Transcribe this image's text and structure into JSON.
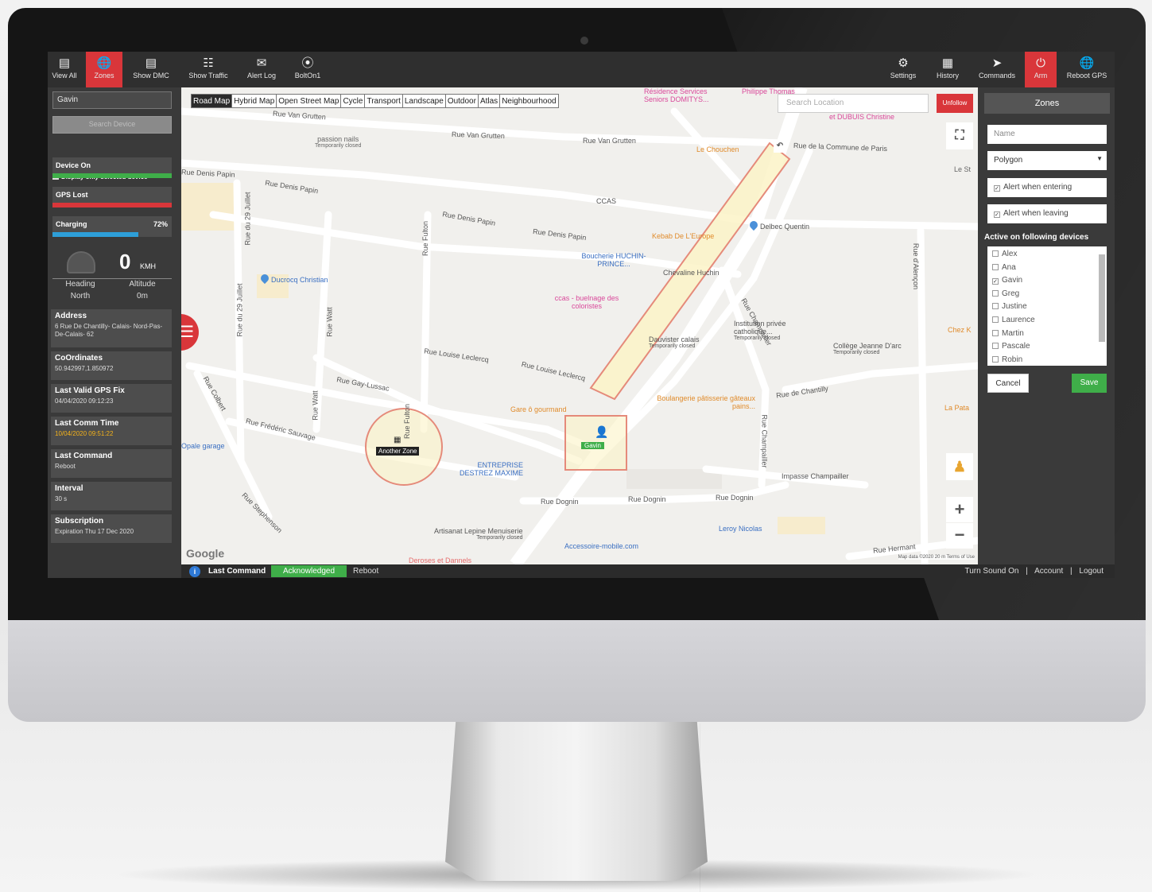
{
  "colors": {
    "accent": "#d9363a",
    "success": "#3fae49",
    "charging": "#2e9fd8",
    "panel": "#3a3a3a",
    "zone_fill": "#fbf3c7",
    "zone_stroke": "#e58a7a"
  },
  "toolbar_left": [
    {
      "label": "View All",
      "icon": "monitor-icon"
    },
    {
      "label": "Zones",
      "icon": "globe-icon",
      "active": true
    },
    {
      "label": "Show DMC",
      "icon": "monitor-icon"
    },
    {
      "label": "Show Traffic",
      "icon": "traffic-light-icon"
    },
    {
      "label": "Alert Log",
      "icon": "envelope-icon"
    },
    {
      "label": "BoltOn1",
      "icon": "bolt-icon"
    }
  ],
  "toolbar_right": [
    {
      "label": "Settings",
      "icon": "gears-icon"
    },
    {
      "label": "History",
      "icon": "calendar-icon"
    },
    {
      "label": "Commands",
      "icon": "paper-plane-icon"
    },
    {
      "label": "Arm",
      "icon": "power-icon",
      "active": true
    },
    {
      "label": "Reboot GPS",
      "icon": "globe-icon"
    }
  ],
  "left_panel": {
    "device_select": "Gavin",
    "search_placeholder": "Search Device",
    "display_only_selected": "Display only selected device",
    "device_on": "Device On",
    "gps_lost": "GPS Lost",
    "charging": "Charging",
    "charging_pct": "72%",
    "charging_level": 0.72,
    "speed": "0",
    "speed_unit": "KMH",
    "heading_label": "Heading",
    "heading_value": "North",
    "altitude_label": "Altitude",
    "altitude_value": "0m",
    "info": [
      {
        "title": "Address",
        "value": "6 Rue De Chantilly- Calais- Nord-Pas-De-Calais- 62"
      },
      {
        "title": "CoOrdinates",
        "value": "50.942997,1.850972"
      },
      {
        "title": "Last Valid GPS Fix",
        "value": "04/04/2020 09:12:23"
      },
      {
        "title": "Last Comm Time",
        "value": "10/04/2020 09:51:22",
        "warn": true
      },
      {
        "title": "Last Command",
        "value": "Reboot"
      },
      {
        "title": "Interval",
        "value": "30 s"
      },
      {
        "title": "Subscription",
        "value": "Expiration Thu 17 Dec 2020"
      }
    ]
  },
  "map": {
    "types": [
      "Road Map",
      "Hybrid Map",
      "Open Street Map",
      "Cycle",
      "Transport",
      "Landscape",
      "Outdoor",
      "Atlas",
      "Neighbourhood"
    ],
    "selected_type": "Road Map",
    "search_placeholder": "Search Location",
    "unfollow": "Unfollow",
    "zone_label": "Another Zone",
    "device_label": "Gavin",
    "google": "Google",
    "footer": "Map data ©2020   20 m   Terms of Use",
    "streets": [
      "Rue Van Grutten",
      "Rue Van Grutten",
      "Rue Van Grutten",
      "Rue de la Commune de Paris",
      "Rue Denis Papin",
      "Rue Denis Papin",
      "Rue Denis Papin",
      "Rue Denis Papin",
      "Rue du 29 Juillet",
      "Rue du 29 Juillet",
      "Rue Fulton",
      "Rue Watt",
      "Rue Watt",
      "Rue Louise Leclercq",
      "Rue Louise Leclercq",
      "Rue Gay-Lussac",
      "Rue Frédéric Sauvage",
      "Rue Colbert",
      "Rue Stephenson",
      "Rue Dognin",
      "Rue Dognin",
      "Rue Dognin",
      "Rue de Chantilly",
      "Rue Champailler",
      "Impasse Champailler",
      "Rue Hermant",
      "Rue d'Alençon",
      "Rue Champailler",
      "Rue Fulton"
    ],
    "pois": [
      {
        "name": "passion nails",
        "sub": "Temporarily closed"
      },
      {
        "name": "CCAS"
      },
      {
        "name": "Delbec Quentin"
      },
      {
        "name": "Ducrocq Christian"
      },
      {
        "name": "Boucherie HUCHIN-PRINCE..."
      },
      {
        "name": "Chevaline Huchin"
      },
      {
        "name": "Kebab De L'Europe"
      },
      {
        "name": "ccas - buelnage des coloristes"
      },
      {
        "name": "Institution privée catholique...",
        "sub": "Temporarily closed"
      },
      {
        "name": "Dauvister calais",
        "sub": "Temporarily closed"
      },
      {
        "name": "Collège Jeanne D'arc",
        "sub": "Temporarily closed"
      },
      {
        "name": "Boulangerie pâtisserie gâteaux pains..."
      },
      {
        "name": "Gare ô gourmand"
      },
      {
        "name": "ENTREPRISE DESTREZ MAXIME"
      },
      {
        "name": "Artisanat Lepine Menuiserie",
        "sub": "Temporarily closed"
      },
      {
        "name": "Accessoire-mobile.com"
      },
      {
        "name": "Leroy Nicolas"
      },
      {
        "name": "Deroses et Dannels"
      },
      {
        "name": "Opale garage"
      },
      {
        "name": "Le Chouchen"
      },
      {
        "name": "Résidence Services Seniors DOMITYS..."
      },
      {
        "name": "Philippe Thomas"
      },
      {
        "name": "et DUBUIS Christine"
      },
      {
        "name": "Chez K"
      },
      {
        "name": "La Pata"
      },
      {
        "name": "Le St"
      }
    ]
  },
  "right_panel": {
    "title": "Zones",
    "name_placeholder": "Name",
    "shape": "Polygon",
    "alert_entering": "Alert when entering",
    "alert_leaving": "Alert when leaving",
    "devices_label": "Active on following devices",
    "devices": [
      {
        "name": "Alex",
        "checked": false
      },
      {
        "name": "Ana",
        "checked": false
      },
      {
        "name": "Gavin",
        "checked": true
      },
      {
        "name": "Greg",
        "checked": false
      },
      {
        "name": "Justine",
        "checked": false
      },
      {
        "name": "Laurence",
        "checked": false
      },
      {
        "name": "Martin",
        "checked": false
      },
      {
        "name": "Pascale",
        "checked": false
      },
      {
        "name": "Robin",
        "checked": false
      }
    ],
    "cancel": "Cancel",
    "save": "Save"
  },
  "bottom_bar": {
    "info_icon": "i",
    "last_command_label": "Last Command",
    "status": "Acknowledged",
    "command": "Reboot",
    "turn_sound_on": "Turn Sound On",
    "account": "Account",
    "logout": "Logout",
    "separator": "|"
  }
}
